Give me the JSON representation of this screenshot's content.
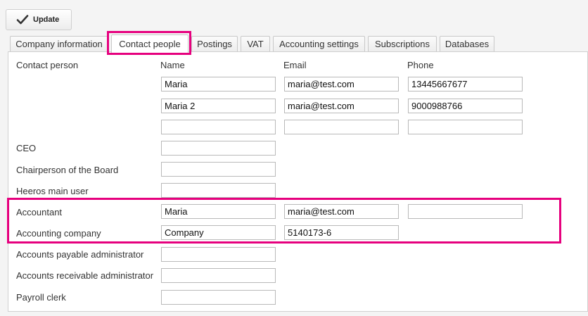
{
  "toolbar": {
    "update_label": "Update"
  },
  "tabs": [
    {
      "label": "Company information"
    },
    {
      "label": "Contact people"
    },
    {
      "label": "Postings"
    },
    {
      "label": "VAT"
    },
    {
      "label": "Accounting settings"
    },
    {
      "label": "Subscriptions"
    },
    {
      "label": "Databases"
    }
  ],
  "active_tab": "Contact people",
  "headers": {
    "name": "Name",
    "email": "Email",
    "phone": "Phone"
  },
  "contact_person": {
    "label": "Contact person",
    "rows": [
      {
        "name": "Maria",
        "email": "maria@test.com",
        "phone": "13445667677"
      },
      {
        "name": "Maria 2",
        "email": "maria@test.com",
        "phone": "9000988766"
      },
      {
        "name": "",
        "email": "",
        "phone": ""
      }
    ]
  },
  "roles": {
    "ceo": {
      "label": "CEO",
      "name": ""
    },
    "chairperson": {
      "label": "Chairperson of the Board",
      "name": ""
    },
    "main_user": {
      "label": "Heeros main user",
      "name": ""
    },
    "accountant": {
      "label": "Accountant",
      "name": "Maria",
      "email": "maria@test.com",
      "phone": ""
    },
    "accounting_company": {
      "label": "Accounting company",
      "name": "Company",
      "business_id": "5140173-6"
    },
    "ap_admin": {
      "label": "Accounts payable administrator",
      "name": ""
    },
    "ar_admin": {
      "label": "Accounts receivable administrator",
      "name": ""
    },
    "payroll": {
      "label": "Payroll clerk",
      "name": ""
    }
  },
  "colors": {
    "highlight": "#e6007e",
    "panel_bg": "#ffffff",
    "page_bg": "#f4f4f4"
  }
}
